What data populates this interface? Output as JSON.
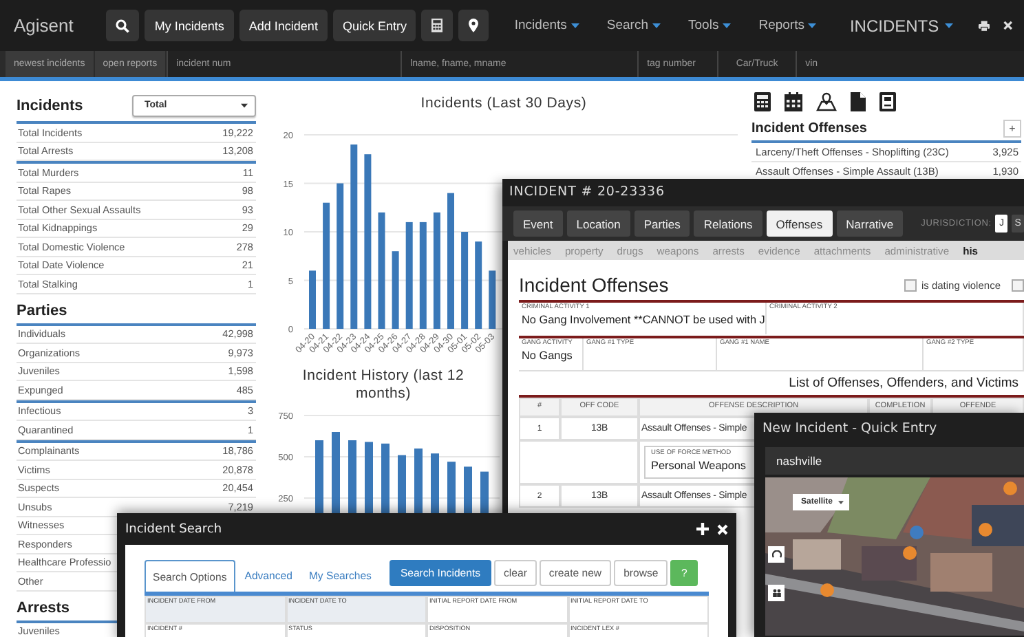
{
  "nav": {
    "logo": "Agisent",
    "buttons": [
      {
        "kind": "search"
      },
      {
        "kind": "text",
        "label": "My Incidents"
      },
      {
        "kind": "text",
        "label": "Add Incident"
      },
      {
        "kind": "text",
        "label": "Quick Entry"
      },
      {
        "kind": "calculator"
      },
      {
        "kind": "pin"
      }
    ],
    "menus": [
      "Incidents",
      "Search",
      "Tools",
      "Reports"
    ],
    "module": "INCIDENTS",
    "actions": [
      {
        "kind": "print"
      },
      {
        "kind": "close"
      }
    ]
  },
  "quick_search": {
    "buttons": [
      "newest incidents",
      "open reports"
    ],
    "fields": [
      {
        "placeholder": "incident num"
      },
      {
        "placeholder": "lname, fname, mname"
      },
      {
        "placeholder": "tag number"
      },
      {
        "placeholder": "Car/Truck"
      },
      {
        "placeholder": "vin"
      }
    ]
  },
  "sidebar": {
    "sections": [
      {
        "title": "Incidents",
        "filter": "Total",
        "groups": [
          [
            {
              "label": "Total Incidents",
              "value": "19,222"
            },
            {
              "label": "Total Arrests",
              "value": "13,208"
            }
          ],
          [
            {
              "label": "Total Murders",
              "value": "11"
            },
            {
              "label": "Total Rapes",
              "value": "98"
            },
            {
              "label": "Total Other Sexual Assaults",
              "value": "93"
            },
            {
              "label": "Total Kidnappings",
              "value": "29"
            },
            {
              "label": "Total Domestic Violence",
              "value": "278"
            },
            {
              "label": "Total Date Violence",
              "value": "21"
            },
            {
              "label": "Total Stalking",
              "value": "1"
            }
          ]
        ]
      },
      {
        "title": "Parties",
        "groups": [
          [
            {
              "label": "Individuals",
              "value": "42,998"
            },
            {
              "label": "Organizations",
              "value": "9,973"
            },
            {
              "label": "Juveniles",
              "value": "1,598"
            },
            {
              "label": "Expunged",
              "value": "485"
            }
          ],
          [
            {
              "label": "Infectious",
              "value": "3"
            },
            {
              "label": "Quarantined",
              "value": "1"
            }
          ],
          [
            {
              "label": "Complainants",
              "value": "18,786"
            },
            {
              "label": "Victims",
              "value": "20,878"
            },
            {
              "label": "Suspects",
              "value": "20,454"
            },
            {
              "label": "Unsubs",
              "value": "7,219"
            },
            {
              "label": "Witnesses"
            },
            {
              "label": "Responders"
            },
            {
              "label": "Healthcare Professio"
            },
            {
              "label": "Other"
            }
          ]
        ]
      },
      {
        "title": "Arrests",
        "groups": [
          [
            {
              "label": "Juveniles"
            }
          ]
        ]
      }
    ]
  },
  "charts": [
    {
      "chart_data": {
        "type": "bar",
        "title": "Incidents (Last 30 Days)",
        "categories": [
          "04-20",
          "04-21",
          "04-22",
          "04-23",
          "04-24",
          "04-25",
          "04-26",
          "04-27",
          "04-28",
          "04-29",
          "04-30",
          "05-01",
          "05-02",
          "05-03"
        ],
        "values": [
          6,
          13,
          15,
          19,
          18,
          12,
          8,
          11,
          11,
          12,
          14,
          10,
          9,
          6
        ],
        "yticks": [
          0,
          5,
          10,
          15,
          20
        ],
        "ylim": [
          0,
          20
        ],
        "grid": true
      }
    },
    {
      "chart_data": {
        "type": "bar",
        "title": "Incident History (last 12 months)",
        "values": [
          600,
          650,
          600,
          590,
          580,
          510,
          550,
          520,
          470,
          440,
          410
        ],
        "yticks": [
          250,
          500,
          750
        ],
        "ylim": [
          0,
          750
        ],
        "grid": true
      }
    }
  ],
  "offense_summary": {
    "toolbar": [
      {
        "kind": "calculator"
      },
      {
        "kind": "calendar"
      },
      {
        "kind": "map"
      },
      {
        "kind": "document"
      },
      {
        "kind": "report"
      }
    ],
    "title": "Incident Offenses",
    "add_label": "+",
    "rows": [
      {
        "label": "Larceny/Theft Offenses - Shoplifting (23C)",
        "value": "3,925"
      },
      {
        "label": "Assault Offenses - Simple Assault (13B)",
        "value": "1,930"
      }
    ]
  },
  "incident_window": {
    "title": "INCIDENT # 20-23336",
    "tabs": [
      {
        "label": "Event",
        "selected": false
      },
      {
        "label": "Location",
        "selected": false
      },
      {
        "label": "Parties",
        "selected": false
      },
      {
        "label": "Relations",
        "selected": false
      },
      {
        "label": "Offenses",
        "selected": true
      },
      {
        "label": "Narrative",
        "selected": false
      }
    ],
    "jurisdiction": {
      "label": "JURISDICTION:",
      "options": [
        {
          "label": "J",
          "selected": true
        },
        {
          "label": "S",
          "selected": false
        }
      ]
    },
    "subtabs": [
      {
        "label": "vehicles",
        "selected": false
      },
      {
        "label": "property",
        "selected": false
      },
      {
        "label": "drugs",
        "selected": false
      },
      {
        "label": "weapons",
        "selected": false
      },
      {
        "label": "arrests",
        "selected": false
      },
      {
        "label": "evidence",
        "selected": false
      },
      {
        "label": "attachments",
        "selected": false
      },
      {
        "label": "administrative",
        "selected": false
      },
      {
        "label": "his",
        "selected": true
      }
    ],
    "heading": "Incident Offenses",
    "checkboxes": [
      {
        "label": "is dating violence",
        "checked": false
      },
      {
        "checked": false
      }
    ],
    "field_rows": [
      [
        {
          "label": "CRIMINAL ACTIVITY 1",
          "value": "No Gang Involvement **CANNOT be used with J"
        },
        {
          "label": "CRIMINAL ACTIVITY 2"
        }
      ],
      [
        {
          "label": "GANG ACTIVITY",
          "value": "No Gangs"
        },
        {
          "label": "GANG #1 TYPE"
        },
        {
          "label": "GANG #1 NAME"
        },
        {
          "label": "GANG #2 TYPE"
        }
      ]
    ],
    "table": {
      "title": "List of Offenses, Offenders, and Victims",
      "columns": [
        "#",
        "OFF CODE",
        "OFFENSE DESCRIPTION",
        "COMPLETION",
        "OFFENDE"
      ],
      "rows": [
        {
          "kind": "offense",
          "number": "1",
          "code": "13B",
          "description": "Assault Offenses - Simple"
        },
        {
          "kind": "detail",
          "label": "USE OF FORCE METHOD",
          "value": "Personal Weapons"
        },
        {
          "kind": "offense",
          "number": "2",
          "code": "13B",
          "description": "Assault Offenses - Simple"
        }
      ]
    }
  },
  "quick_entry_window": {
    "title": "New Incident - Quick Entry",
    "location": "nashville",
    "map": {
      "kind": "picture",
      "map_type": "Satellite"
    }
  },
  "search_window": {
    "title": "Incident Search",
    "tabs": [
      {
        "label": "Search Options",
        "selected": true
      },
      {
        "label": "Advanced",
        "selected": false
      },
      {
        "label": "My Searches",
        "selected": false
      }
    ],
    "buttons": [
      {
        "kind": "primary",
        "label": "Search Incidents"
      },
      {
        "kind": "default",
        "label": "clear"
      },
      {
        "kind": "default",
        "label": "create new"
      },
      {
        "kind": "default",
        "label": "browse"
      },
      {
        "kind": "help",
        "label": "?"
      }
    ],
    "fields": [
      {
        "label": "INCIDENT DATE FROM",
        "disabled": true
      },
      {
        "label": "INCIDENT DATE TO",
        "disabled": true
      },
      {
        "label": "INITIAL REPORT DATE FROM",
        "disabled": false
      },
      {
        "label": "INITIAL REPORT DATE TO",
        "disabled": false
      },
      {
        "label": "INCIDENT #",
        "disabled": false
      },
      {
        "label": "STATUS",
        "disabled": false
      },
      {
        "label": "DISPOSITION",
        "disabled": false
      },
      {
        "label": "INCIDENT LEX #",
        "disabled": false
      }
    ]
  }
}
